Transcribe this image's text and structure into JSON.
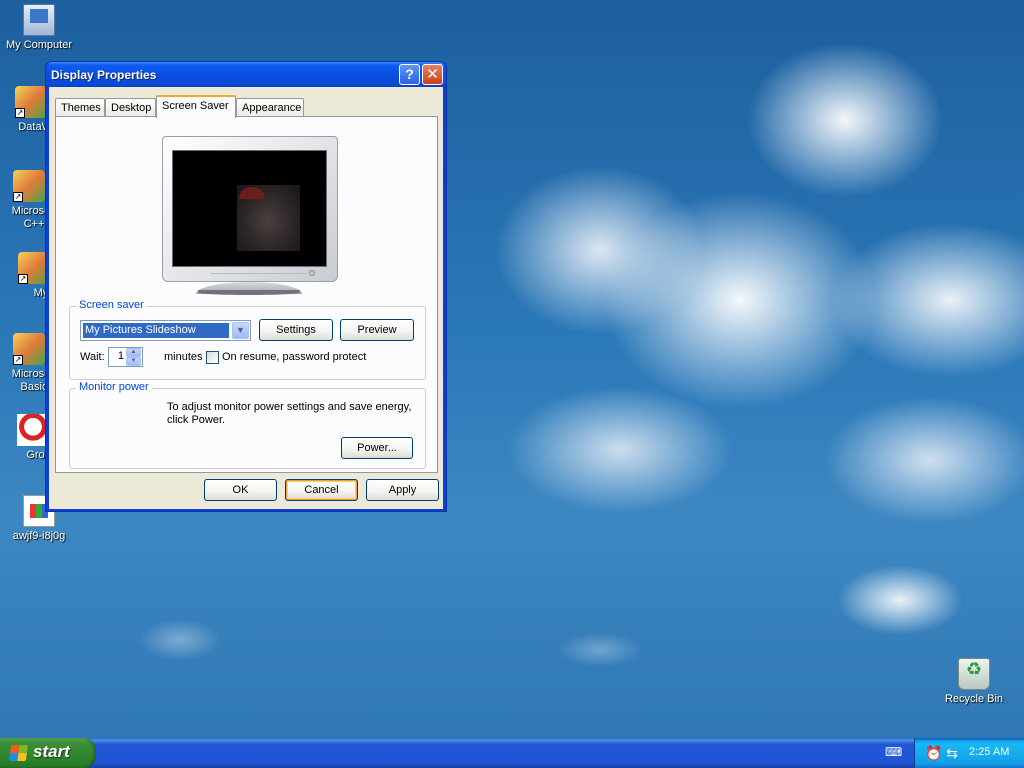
{
  "desktop": {
    "icons": [
      {
        "label": "My Computer",
        "icon": "computer-icon"
      },
      {
        "label": "DataWa",
        "icon": "shortcut-icon"
      },
      {
        "label": "Microsoft C++",
        "icon": "shortcut-icon"
      },
      {
        "label": "Myp",
        "icon": "shortcut-icon"
      },
      {
        "label": "Microsoft Basic",
        "icon": "shortcut-icon"
      },
      {
        "label": "Gross",
        "icon": "shortcut-icon"
      },
      {
        "label": "awjf9-i8j0g",
        "icon": "image-file-icon"
      },
      {
        "label": "Recycle Bin",
        "icon": "recycle-bin-icon"
      }
    ]
  },
  "window": {
    "title": "Display Properties",
    "help_glyph": "?",
    "close_glyph": "✕",
    "tabs": [
      "Themes",
      "Desktop",
      "Screen Saver",
      "Appearance"
    ],
    "active_tab": "Screen Saver",
    "screen_saver": {
      "group_title": "Screen saver",
      "selected": "My Pictures Slideshow",
      "settings_label": "Settings",
      "preview_label": "Preview",
      "wait_label": "Wait:",
      "wait_value": "1",
      "minutes_label": "minutes",
      "password_label": "On resume, password protect",
      "password_checked": false
    },
    "monitor_power": {
      "group_title": "Monitor power",
      "text": "To adjust monitor power settings and save energy, click Power.",
      "power_label": "Power..."
    },
    "buttons": {
      "ok": "OK",
      "cancel": "Cancel",
      "apply": "Apply"
    }
  },
  "taskbar": {
    "start_label": "start",
    "clock": "2:25 AM",
    "tray_icons": [
      "keyboard-icon",
      "alarm-clock-icon",
      "network-icon"
    ]
  },
  "colors": {
    "titlebar": "#0a4fe0",
    "group_title": "#0046d5",
    "selection": "#316ac5",
    "start_green": "#2f862f"
  }
}
